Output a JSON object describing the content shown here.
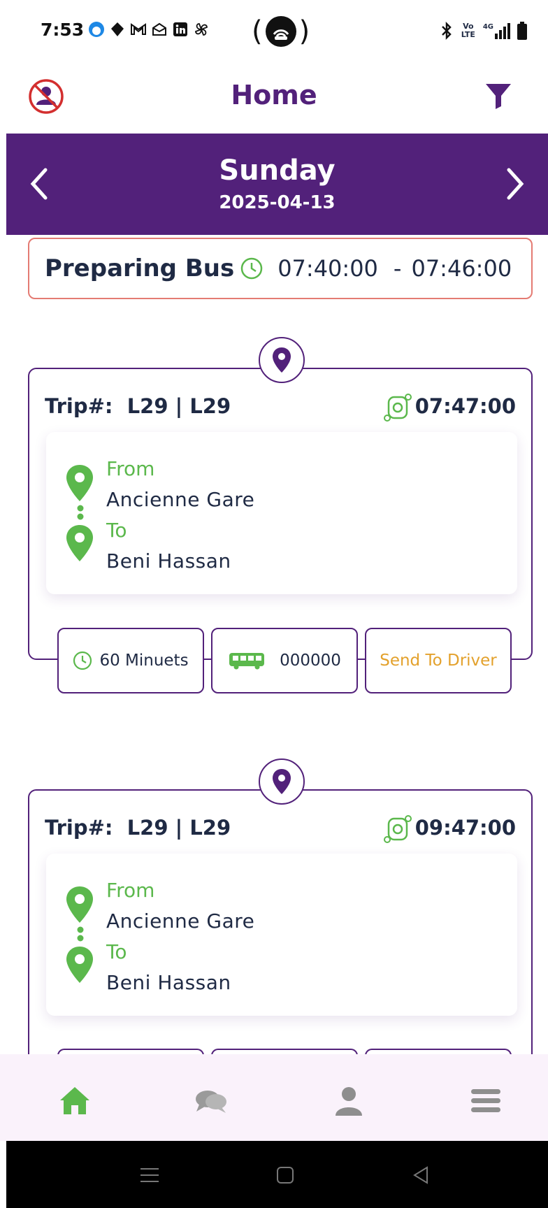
{
  "status_bar": {
    "time": "7:53",
    "icons_left": [
      "cloud-icon",
      "diamond-icon",
      "gmail-icon",
      "mail-open-icon",
      "linkedin-icon",
      "pinwheel-icon"
    ],
    "icons_right": [
      "bluetooth-icon",
      "volte-icon",
      "signal-4g-icon",
      "battery-icon"
    ],
    "volte_label": "Vo LTE",
    "network_label": "4G"
  },
  "header": {
    "title": "Home"
  },
  "date_bar": {
    "day": "Sunday",
    "date": "2025-04-13"
  },
  "preparing": {
    "label": "Preparing Bus",
    "start": "07:40:00",
    "separator": "-",
    "end": "07:46:00"
  },
  "trips": [
    {
      "trip_label": "Trip#:",
      "trip_id": "L29 | L29",
      "time": "07:47:00",
      "from_label": "From",
      "from": "Ancienne Gare",
      "to_label": "To",
      "to": "Beni Hassan",
      "duration": "60 Minuets",
      "bus_number": "000000",
      "send_label": "Send To Driver"
    },
    {
      "trip_label": "Trip#:",
      "trip_id": "L29 | L29",
      "time": "09:47:00",
      "from_label": "From",
      "from": "Ancienne Gare",
      "to_label": "To",
      "to": "Beni Hassan"
    }
  ],
  "colors": {
    "primary": "#52217a",
    "accent_green": "#5bb84c",
    "warning_orange": "#e3a12c",
    "banner_border": "#e47b73",
    "text_dark": "#1f2a44"
  },
  "bottom_nav": [
    "home-icon",
    "chat-icon",
    "profile-icon",
    "menu-icon"
  ]
}
